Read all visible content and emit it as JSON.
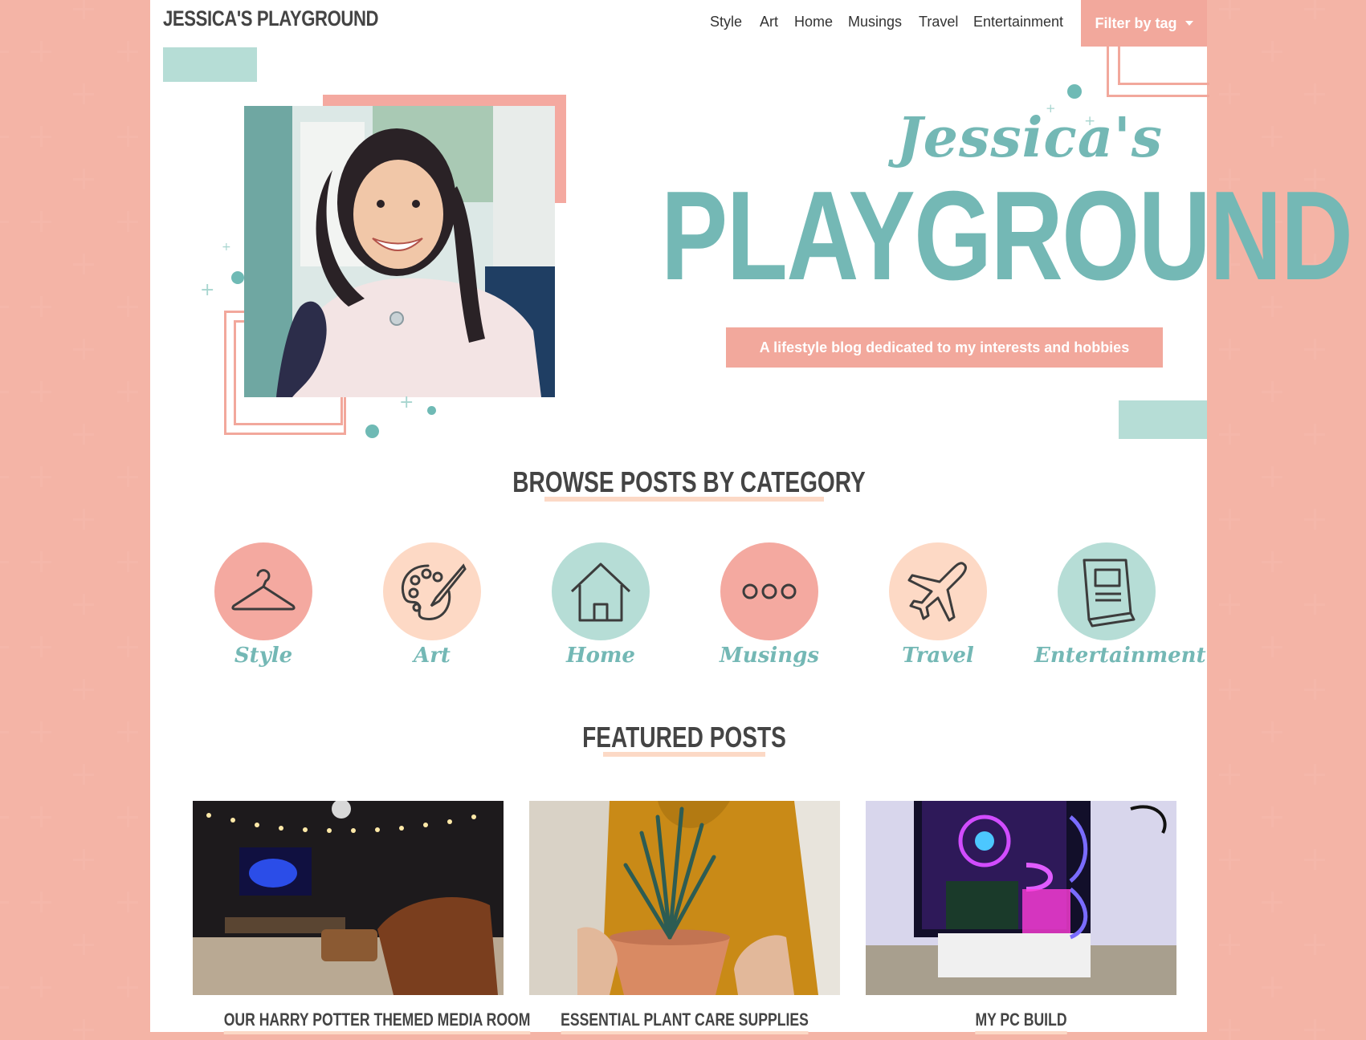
{
  "site": {
    "brand": "JESSICA'S PLAYGROUND",
    "nav": [
      "Style",
      "Art",
      "Home",
      "Musings",
      "Travel",
      "Entertainment"
    ],
    "filter_label": "Filter by tag"
  },
  "hero": {
    "script_title": "Jessica's",
    "title": "PLAYGROUND",
    "tagline": "A lifestyle blog dedicated to my interests and hobbies"
  },
  "categories": {
    "heading": "BROWSE POSTS BY CATEGORY",
    "items": [
      {
        "label": "Style",
        "icon": "hanger-icon",
        "color": "#f4a9a0"
      },
      {
        "label": "Art",
        "icon": "palette-icon",
        "color": "#fdd9c5"
      },
      {
        "label": "Home",
        "icon": "house-icon",
        "color": "#b6ddd6"
      },
      {
        "label": "Musings",
        "icon": "ellipsis-icon",
        "color": "#f4a9a0"
      },
      {
        "label": "Travel",
        "icon": "airplane-icon",
        "color": "#fdd9c5"
      },
      {
        "label": "Entertainment",
        "icon": "book-icon",
        "color": "#b6ddd6"
      }
    ]
  },
  "featured": {
    "heading": "FEATURED POSTS",
    "posts": [
      {
        "title": "OUR HARRY POTTER THEMED MEDIA ROOM"
      },
      {
        "title": "ESSENTIAL PLANT CARE SUPPLIES"
      },
      {
        "title": "MY PC BUILD"
      }
    ]
  },
  "colors": {
    "pink": "#f2a89c",
    "mint": "#b6ddd6",
    "teal": "#74b8b5",
    "peach": "#fdd9c5"
  }
}
